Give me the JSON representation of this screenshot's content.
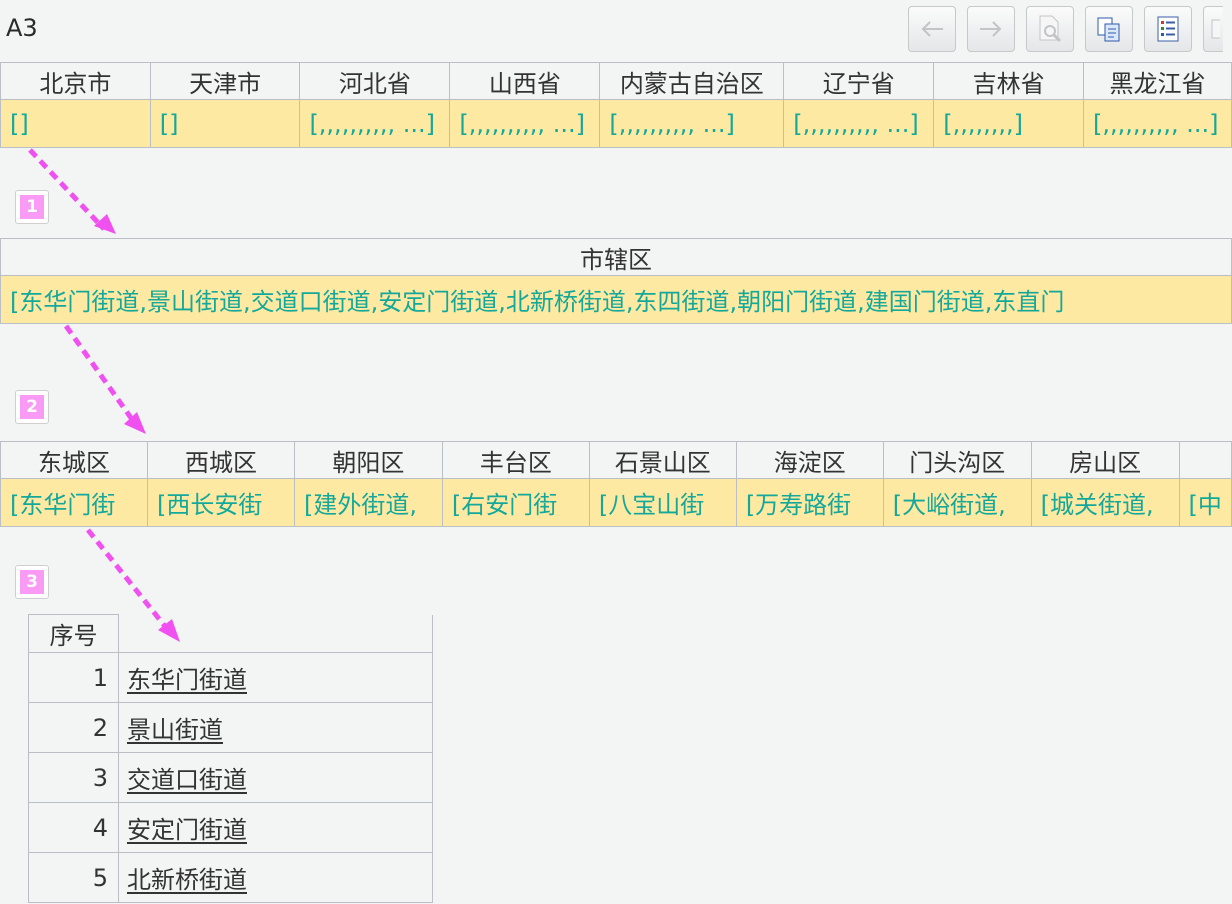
{
  "cell_ref": "A3",
  "toolbar": {
    "buttons": [
      {
        "name": "back-arrow-icon"
      },
      {
        "name": "forward-arrow-icon"
      },
      {
        "name": "zoom-page-icon"
      },
      {
        "name": "copy-icon"
      },
      {
        "name": "list-panel-icon"
      }
    ]
  },
  "level1": {
    "headers": [
      "北京市",
      "天津市",
      "河北省",
      "山西省",
      "内蒙古自治区",
      "辽宁省",
      "吉林省",
      "黑龙江省"
    ],
    "values": [
      "[]",
      "[]",
      "[,,,,,,,,,, ...]",
      "[,,,,,,,,,, ...]",
      "[,,,,,,,,,, ...]",
      "[,,,,,,,,,, ...]",
      "[,,,,,,,,]",
      "[,,,,,,,,,, ...]"
    ]
  },
  "level2": {
    "header": "市辖区",
    "value": "[东华门街道,景山街道,交道口街道,安定门街道,北新桥街道,东四街道,朝阳门街道,建国门街道,东直门"
  },
  "level3": {
    "headers": [
      "东城区",
      "西城区",
      "朝阳区",
      "丰台区",
      "石景山区",
      "海淀区",
      "门头沟区",
      "房山区",
      ""
    ],
    "values": [
      "[东华门街",
      "[西长安街",
      "[建外街道,",
      "[右安门街",
      "[八宝山街",
      "[万寿路街",
      "[大峪街道,",
      "[城关街道,",
      "[中"
    ]
  },
  "steps": [
    "1",
    "2",
    "3"
  ],
  "sequence": {
    "header_index": "序号",
    "header_name": "",
    "rows": [
      {
        "index": "1",
        "name": "东华门街道"
      },
      {
        "index": "2",
        "name": "景山街道"
      },
      {
        "index": "3",
        "name": "交道口街道"
      },
      {
        "index": "4",
        "name": "安定门街道"
      },
      {
        "index": "5",
        "name": "北新桥街道"
      }
    ]
  },
  "colors": {
    "header_bg": "#f3f4f4",
    "value_bg": "#fee9a2",
    "value_text": "#14a89a",
    "arrow": "#f050f0",
    "badge": "#f99af4"
  }
}
